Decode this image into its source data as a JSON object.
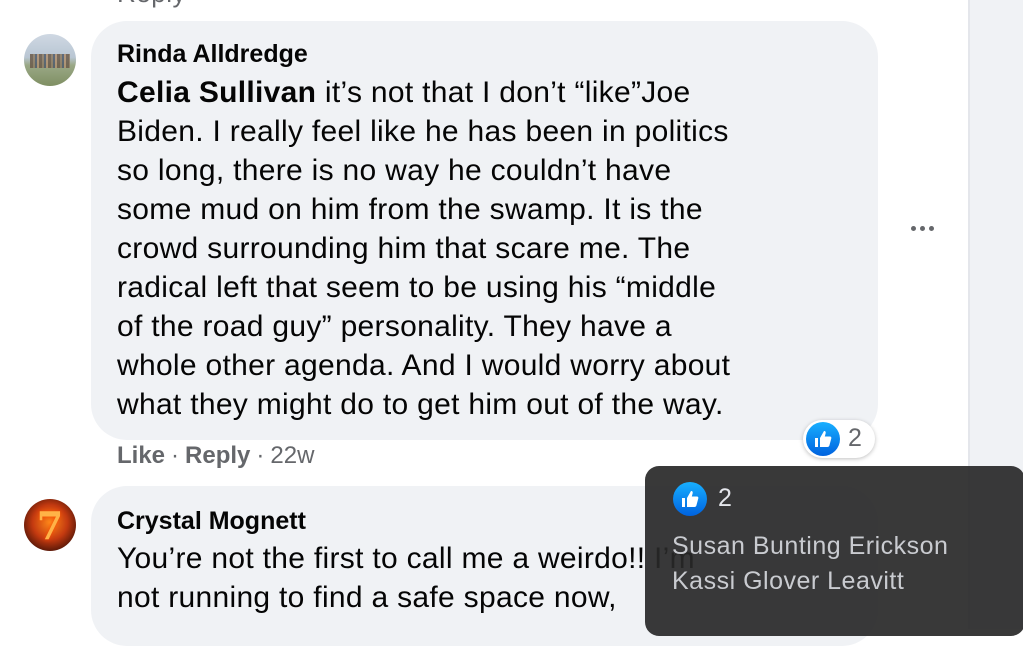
{
  "top_partial_text": "Reply",
  "comments": [
    {
      "author": "Rinda Alldredge",
      "mention": "Celia Sullivan",
      "lines": [
        " it’s not that I don’t “like”Joe",
        "Biden. I really feel like he has been in politics",
        "so long, there is no way he couldn’t have",
        "some mud on him from the swamp. It is the",
        "crowd surrounding him that scare me. The",
        "radical left that seem to be using his “middle",
        "of the road guy” personality. They have a",
        "whole other agenda. And I would worry about",
        "what they might do to get him out of the way."
      ],
      "actions": {
        "like": "Like",
        "reply": "Reply",
        "separator": "·",
        "time": "22w"
      },
      "reactions": {
        "icon": "like-icon",
        "count": "2"
      },
      "more_icon": "ellipsis-icon"
    },
    {
      "author": "Crystal Mognett",
      "lines": [
        "You’re not the first to call me a weirdo!! I’m",
        "not running to find a safe space now,"
      ]
    }
  ],
  "tooltip": {
    "icon": "like-icon",
    "count": "2",
    "names": [
      "Susan Bunting Erickson",
      "Kassi Glover Leavitt"
    ]
  },
  "colors": {
    "bubble": "#f0f2f5",
    "meta_text": "#65676b",
    "like_blue": "#1877f2"
  }
}
